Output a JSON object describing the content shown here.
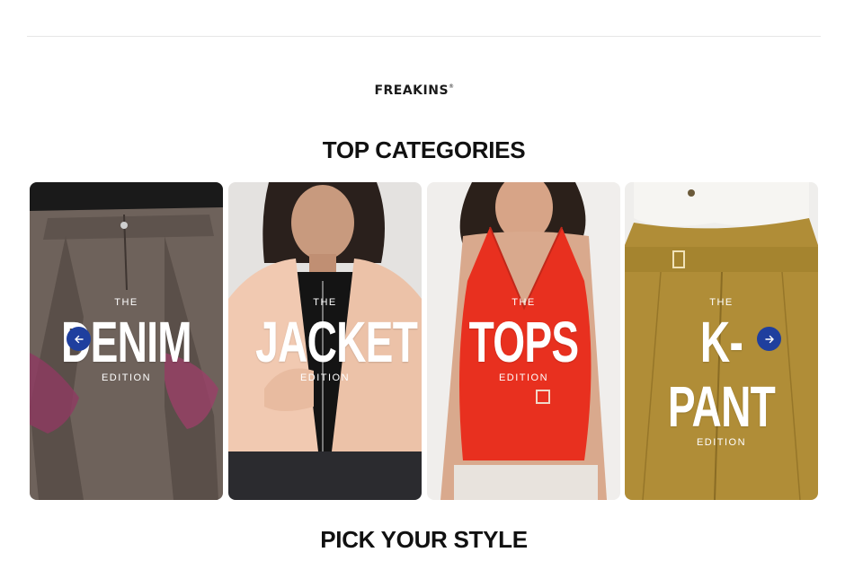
{
  "brand": {
    "name": "FREAKINS",
    "mark": "®"
  },
  "sections": {
    "top_categories_title": "TOP CATEGORIES",
    "pick_style_title": "PICK YOUR STYLE"
  },
  "categories": [
    {
      "prefix": "THE",
      "name": "DENIM",
      "suffix": "EDITION"
    },
    {
      "prefix": "THE",
      "name": "JACKET",
      "suffix": "EDITION"
    },
    {
      "prefix": "THE",
      "name": "TOPS",
      "suffix": "EDITION"
    },
    {
      "prefix": "THE",
      "name": "K-PANT",
      "suffix": "EDITION"
    }
  ],
  "carousel": {
    "prev_icon": "arrow-left-icon",
    "next_icon": "arrow-right-icon",
    "button_color": "#1f3f9e"
  }
}
